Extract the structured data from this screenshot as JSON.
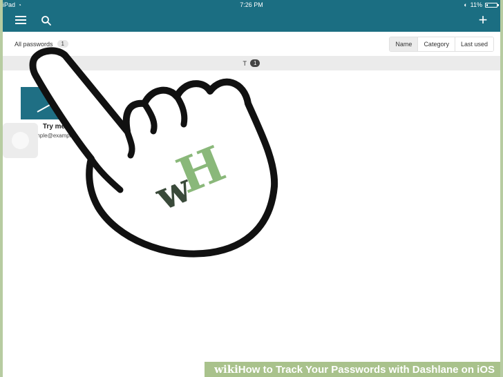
{
  "status_bar": {
    "device": "iPad",
    "time": "7:26 PM",
    "battery": "11%",
    "battery_level": 0.11
  },
  "nav": {
    "add_label": "+"
  },
  "filter": {
    "all_label": "All passwords",
    "count": "1",
    "sort_options": [
      "Name",
      "Category",
      "Last used"
    ],
    "active_sort": "Name"
  },
  "section": {
    "letter": "T",
    "count": "1"
  },
  "card": {
    "name": "Try me",
    "email": "example@example.co"
  },
  "caption": {
    "wiki": "wiki",
    "how": "How",
    "rest": " to Track Your Passwords with Dashlane on iOS"
  },
  "watermark": {
    "w": "w",
    "h": "H"
  },
  "colors": {
    "header": "#1b6e82",
    "accent_green": "#8ab87a",
    "dark_green": "#3a4a3a"
  }
}
